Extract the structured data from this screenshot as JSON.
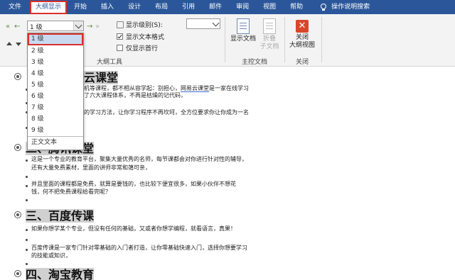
{
  "tabs": [
    "文件",
    "大纲显示",
    "开始",
    "插入",
    "设计",
    "布局",
    "引用",
    "邮件",
    "审阅",
    "视图",
    "帮助"
  ],
  "tell_me": "操作说明搜索",
  "outline_tools": {
    "level_value": "1 级",
    "show_level_label": "显示级别(S):",
    "show_text_format": "显示文本格式",
    "show_first_line": "仅显示首行",
    "group_label": "大纲工具"
  },
  "master_doc": {
    "show_doc": "显示文档",
    "collapse_subdocs": [
      "折叠",
      "子文档"
    ],
    "group_label": "主控文档"
  },
  "close_group": {
    "close_label": [
      "关闭",
      "大纲视图"
    ],
    "group_label": "关闭"
  },
  "dropdown": {
    "items": [
      "1 级",
      "2 级",
      "3 级",
      "4 级",
      "5 级",
      "6 级",
      "7 级",
      "8 级",
      "9 级"
    ],
    "body_text": "正文文本"
  },
  "document": {
    "h1": "云课堂",
    "h1_line1a": "机等课程，都不相从容学起：别担心，",
    "h1_line1b": "网易云课堂",
    "h1_line1c": "是一家在线学习",
    "h1_line2": "了六大课程体系，不再是枯燥的记代码，",
    "h1_line3": "的学习方法，让你学习程序不再坎坷，全方位要求你让你成为一名",
    "h2": "二、腾讯课堂",
    "h2_line1": "这是一个专业的教育平台，聚集大量优秀的名师，每节课都会对你进行针对性的辅导，",
    "h2_line2": "还有大量免费素材，里面的讲师非常和蔼可亲，",
    "h2_line3": "并且里面的课程都是免费，就算是要钱的，也比较下便宜很多，如果小伙伴不想花",
    "h2_line4": "钱，何不把免费课程给看完呢？",
    "h3": "三、百度传课",
    "h3_line1": "如果你想学某个专业，但没有任何的基础，又或者你想学编程，就看语言，真果！",
    "h3_line2": "百度传课是一家专门针对零基础的入门者打造，让你零基础快速入门，选择你想要学习",
    "h3_line3": "的技能或知识，",
    "h4": "四、淘宝教育"
  },
  "colors": {
    "ribbon_blue": "#2b579a",
    "highlight_red": "#d9302c",
    "heading_highlight": "#d0d0d0"
  }
}
